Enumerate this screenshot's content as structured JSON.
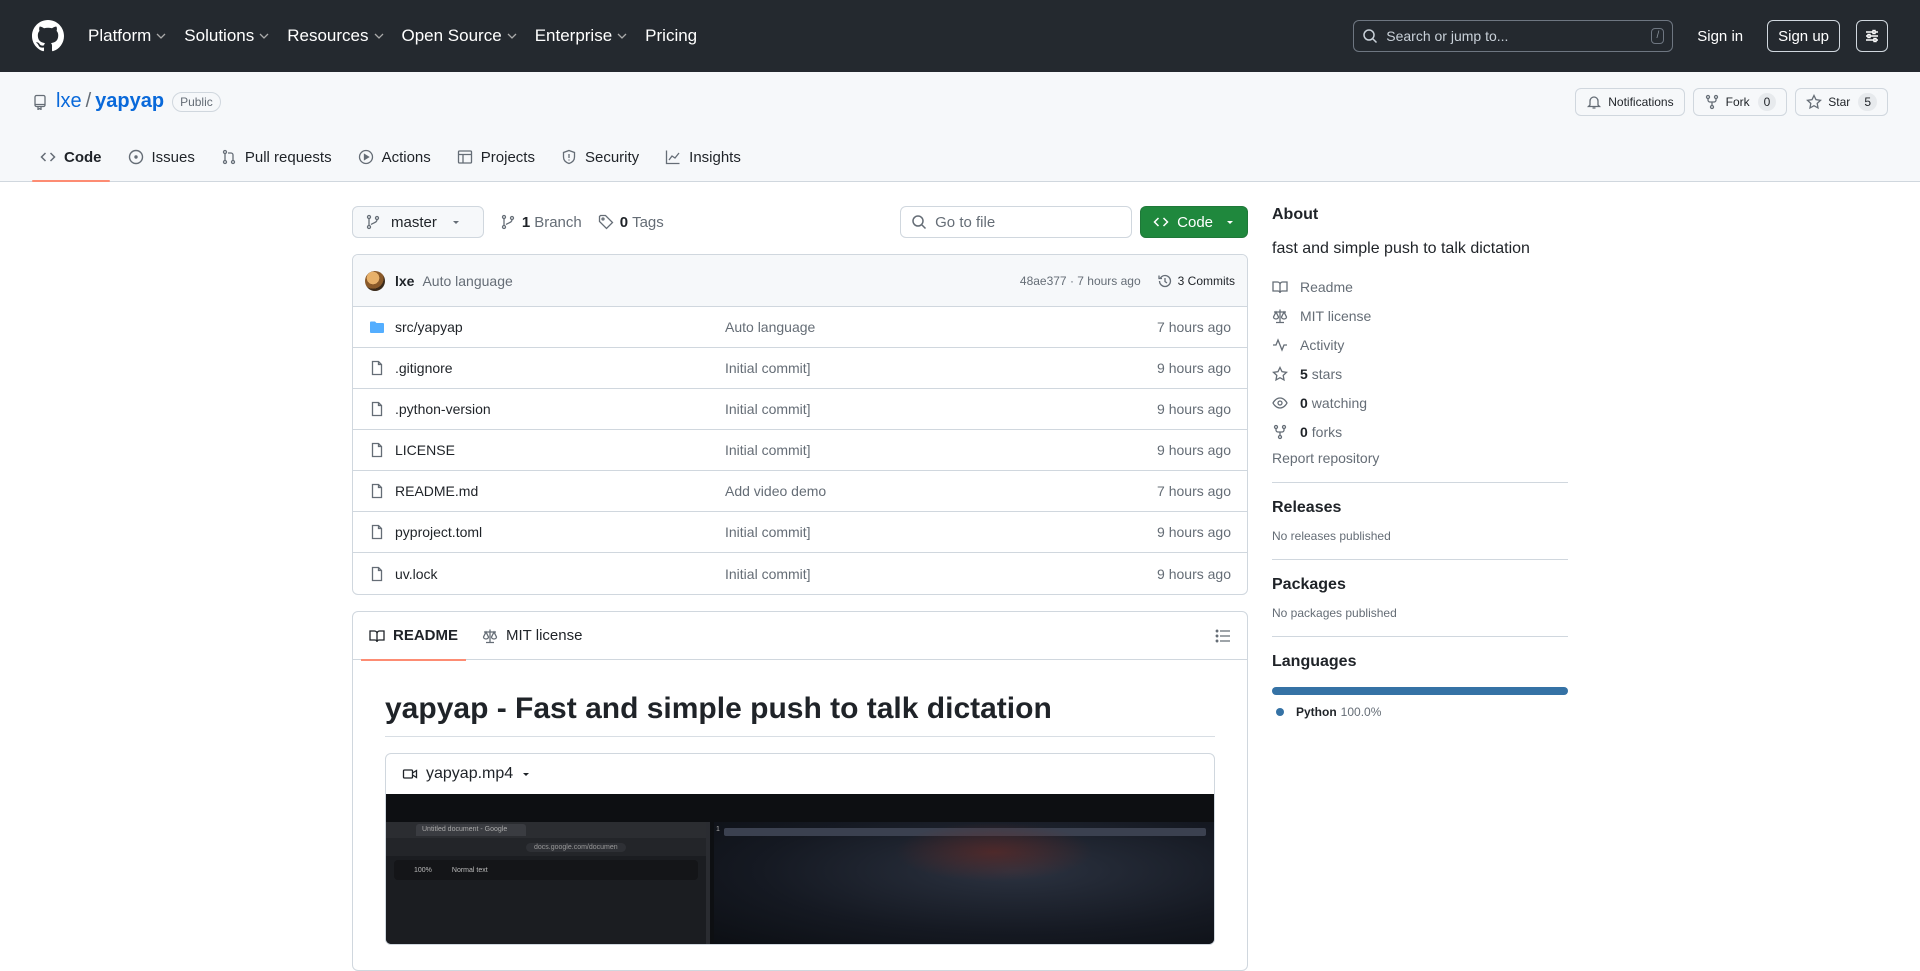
{
  "colors": {
    "header_bg": "#24292f",
    "accent_blue": "#0969da",
    "code_btn_green": "#1f883d",
    "tab_underline": "#fd8c73",
    "python_color": "#3572a5"
  },
  "topnav": {
    "items": [
      "Platform",
      "Solutions",
      "Resources",
      "Open Source",
      "Enterprise",
      "Pricing"
    ],
    "search_placeholder": "Search or jump to...",
    "search_shortcut": "/",
    "sign_in": "Sign in",
    "sign_up": "Sign up"
  },
  "repo": {
    "owner": "lxe",
    "separator": "/",
    "name": "yapyap",
    "visibility": "Public",
    "notifications_label": "Notifications",
    "fork_label": "Fork",
    "fork_count": "0",
    "star_label": "Star",
    "star_count": "5"
  },
  "reponav": {
    "items": [
      "Code",
      "Issues",
      "Pull requests",
      "Actions",
      "Projects",
      "Security",
      "Insights"
    ]
  },
  "toolbar": {
    "branch": "master",
    "branch_count": "1",
    "branch_label": "Branch",
    "tag_count": "0",
    "tag_label": "Tags",
    "goto_placeholder": "Go to file",
    "code_label": "Code"
  },
  "latest_commit": {
    "author": "lxe",
    "message": "Auto language",
    "meta": "48ae377 · 7 hours ago",
    "commits_label": "3 Commits"
  },
  "files": [
    {
      "type": "dir",
      "name": "src/yapyap",
      "message": "Auto language",
      "date": "7 hours ago"
    },
    {
      "type": "file",
      "name": ".gitignore",
      "message": "Initial commit]",
      "date": "9 hours ago"
    },
    {
      "type": "file",
      "name": ".python-version",
      "message": "Initial commit]",
      "date": "9 hours ago"
    },
    {
      "type": "file",
      "name": "LICENSE",
      "message": "Initial commit]",
      "date": "9 hours ago"
    },
    {
      "type": "file",
      "name": "README.md",
      "message": "Add video demo",
      "date": "7 hours ago"
    },
    {
      "type": "file",
      "name": "pyproject.toml",
      "message": "Initial commit]",
      "date": "9 hours ago"
    },
    {
      "type": "file",
      "name": "uv.lock",
      "message": "Initial commit]",
      "date": "9 hours ago"
    }
  ],
  "readme": {
    "tab_readme": "README",
    "tab_license": "MIT license",
    "heading": "yapyap - Fast and simple push to talk dictation",
    "video_name": "yapyap.mp4",
    "video_preview": {
      "tab_title": "Untitled document - Google",
      "url": "docs.google.com/documen",
      "zoom": "100%",
      "style": "Normal text",
      "line_number": "1"
    }
  },
  "about": {
    "title": "About",
    "description": "fast and simple push to talk dictation",
    "readme": "Readme",
    "license": "MIT license",
    "activity": "Activity",
    "stars_count": "5",
    "stars_label": "stars",
    "watching_count": "0",
    "watching_label": "watching",
    "forks_count": "0",
    "forks_label": "forks",
    "report": "Report repository"
  },
  "releases": {
    "title": "Releases",
    "empty": "No releases published"
  },
  "packages": {
    "title": "Packages",
    "empty": "No packages published"
  },
  "languages": {
    "title": "Languages",
    "items": [
      {
        "name": "Python",
        "percent": "100.0%"
      }
    ]
  }
}
